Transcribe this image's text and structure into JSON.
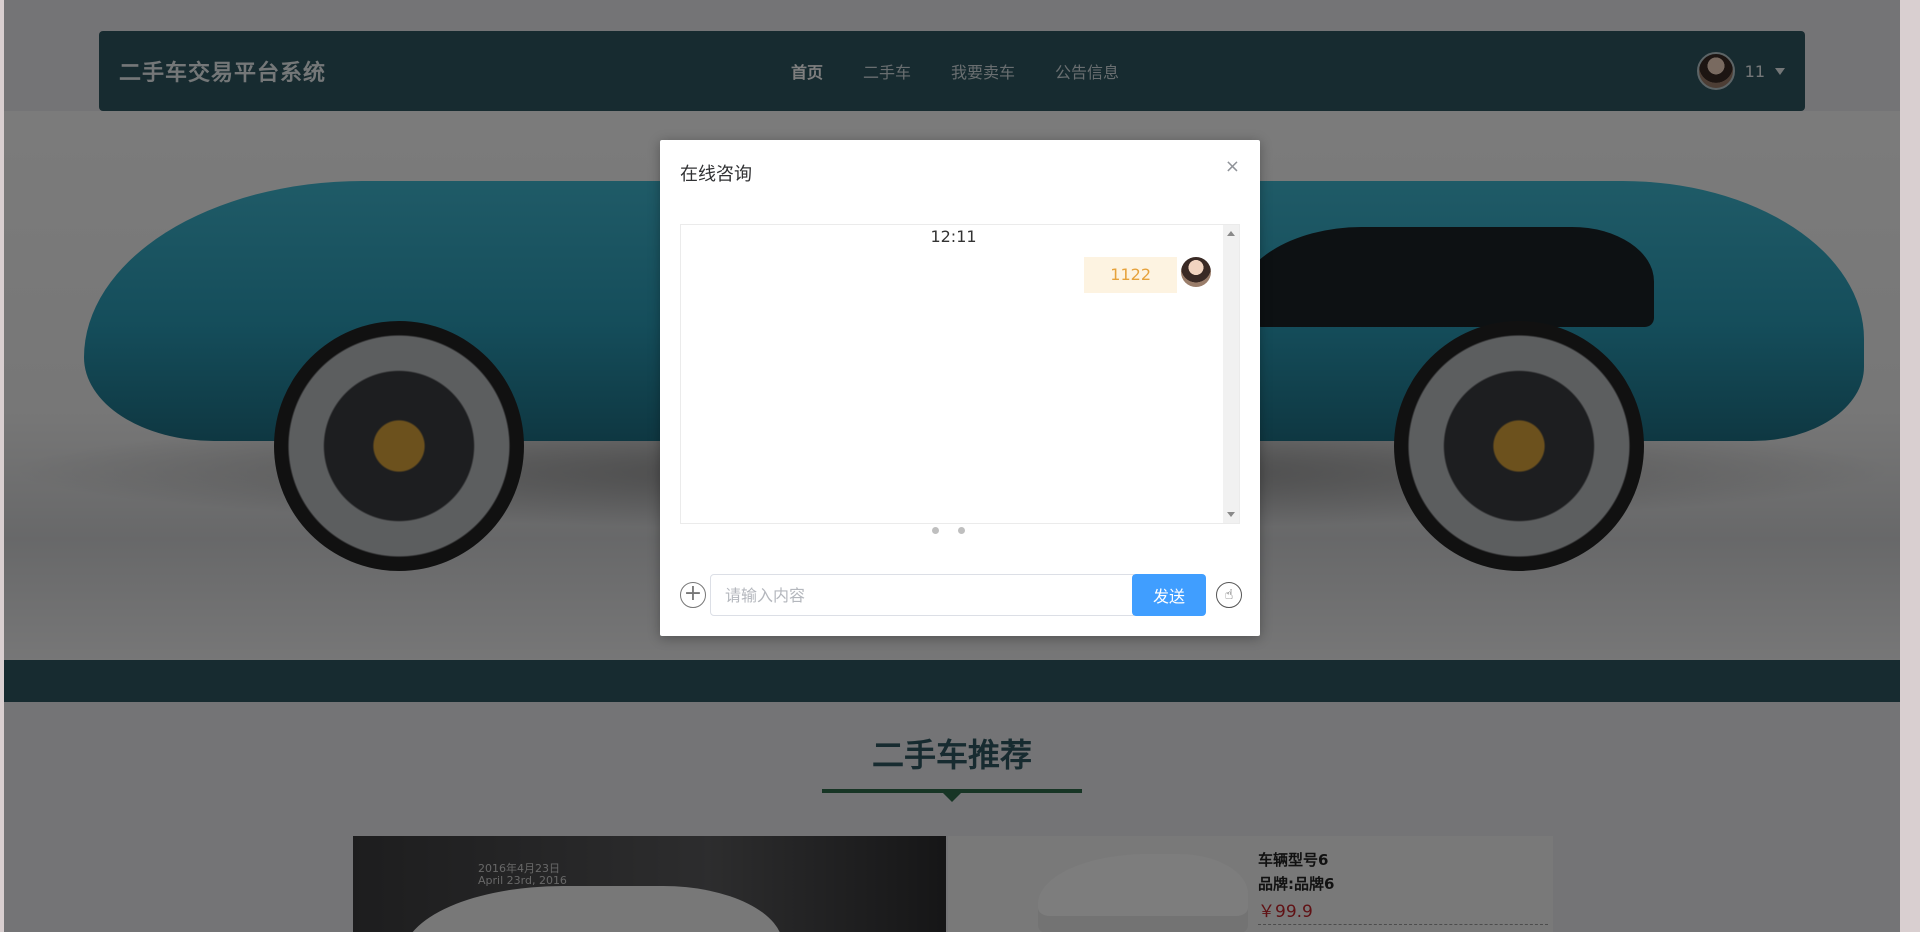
{
  "header": {
    "brand": "二手车交易平台系统",
    "nav": [
      "首页",
      "二手车",
      "我要卖车",
      "公告信息"
    ],
    "active_nav": "首页",
    "user_name": "11"
  },
  "section": {
    "title": "二手车推荐"
  },
  "cards": {
    "left_date_cn": "2016年4月23日",
    "left_date_en": "April 23rd, 2016",
    "right_model": "车辆型号6",
    "right_brand": "品牌:品牌6",
    "right_price": "￥99.9"
  },
  "dialog": {
    "title": "在线咨询",
    "close": "×",
    "time": "12:11",
    "message": "1122",
    "input_placeholder": "请输入内容",
    "send_label": "发送",
    "plus": "+"
  },
  "colors": {
    "header_bg": "#2f5660",
    "accent": "#409eff",
    "bubble_bg": "#fdf3e1",
    "bubble_text": "#e6a23c",
    "price": "#c0242a"
  }
}
